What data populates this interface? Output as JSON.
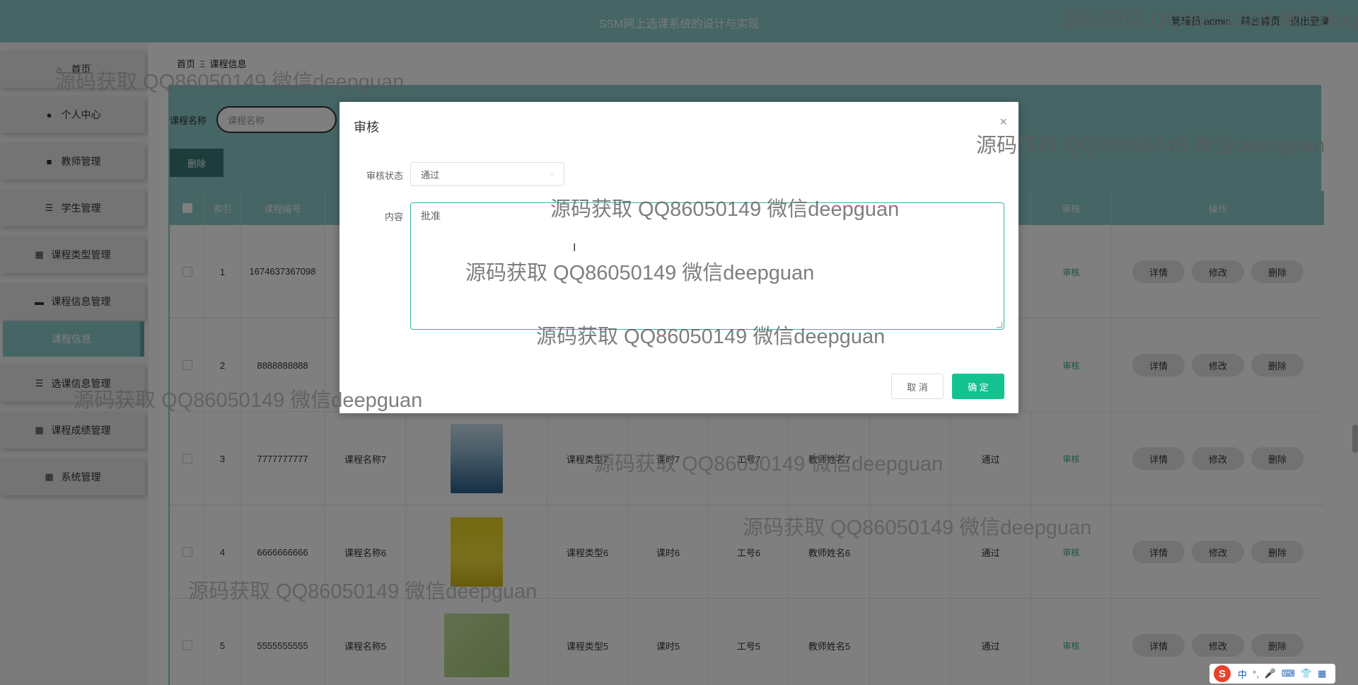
{
  "header": {
    "title": "SSM网上选课系统的设计与实现",
    "user_text": "管理员 admin",
    "front_link": "前台首页",
    "logout": "退出登录"
  },
  "sidebar": {
    "items": [
      {
        "label": "首页",
        "icon": "home-icon"
      },
      {
        "label": "个人中心",
        "icon": "user-icon"
      },
      {
        "label": "教师管理",
        "icon": "briefcase-icon"
      },
      {
        "label": "学生管理",
        "icon": "list-icon"
      },
      {
        "label": "课程类型管理",
        "icon": "grid-icon"
      },
      {
        "label": "课程信息管理",
        "icon": "book-icon"
      },
      {
        "label": "课程信息",
        "icon": ""
      },
      {
        "label": "选课信息管理",
        "icon": "list-icon"
      },
      {
        "label": "课程成绩管理",
        "icon": "grid-icon"
      },
      {
        "label": "系统管理",
        "icon": "grid-icon"
      }
    ]
  },
  "breadcrumb": {
    "home": "首页",
    "separator": "Ξ",
    "current": "课程信息"
  },
  "search": {
    "label": "课程名称",
    "placeholder": "课程名称"
  },
  "toolbar": {
    "delete_label": "删除"
  },
  "table": {
    "headers": [
      "",
      "索引",
      "课程编号",
      "",
      "",
      "",
      "",
      "",
      "",
      "",
      "",
      "审核",
      "操作"
    ],
    "rows": [
      {
        "index": "1",
        "code": "1674637367098",
        "name": "",
        "type": "",
        "hours": "",
        "teacher_no": "",
        "teacher_name": "",
        "status": "",
        "audit": "审核"
      },
      {
        "index": "2",
        "code": "8888888888",
        "name": "",
        "type": "",
        "hours": "",
        "teacher_no": "",
        "teacher_name": "",
        "status": "",
        "audit": "审核"
      },
      {
        "index": "3",
        "code": "7777777777",
        "name": "课程名称7",
        "type": "课程类型7",
        "hours": "课时7",
        "teacher_no": "工号7",
        "teacher_name": "教师姓名7",
        "status": "通过",
        "audit": "审核"
      },
      {
        "index": "4",
        "code": "6666666666",
        "name": "课程名称6",
        "type": "课程类型6",
        "hours": "课时6",
        "teacher_no": "工号6",
        "teacher_name": "教师姓名6",
        "status": "通过",
        "audit": "审核"
      },
      {
        "index": "5",
        "code": "5555555555",
        "name": "课程名称5",
        "type": "课程类型5",
        "hours": "课时5",
        "teacher_no": "工号5",
        "teacher_name": "教师姓名5",
        "status": "通过",
        "audit": "审核"
      }
    ],
    "ops": {
      "detail": "详情",
      "edit": "修改",
      "delete": "删除"
    }
  },
  "dialog": {
    "title": "审核",
    "close": "×",
    "status_label": "审核状态",
    "status_value": "通过",
    "content_label": "内容",
    "content_value": "批准",
    "cancel_label": "取 消",
    "ok_label": "确 定"
  },
  "watermark": "源码获取 QQ86050149 微信deepguan",
  "ime": {
    "logo": "S",
    "mode": "中"
  },
  "colors": {
    "theme": "#8ccaca",
    "confirm": "#13c28f",
    "audit_link": "#2faf7a"
  }
}
